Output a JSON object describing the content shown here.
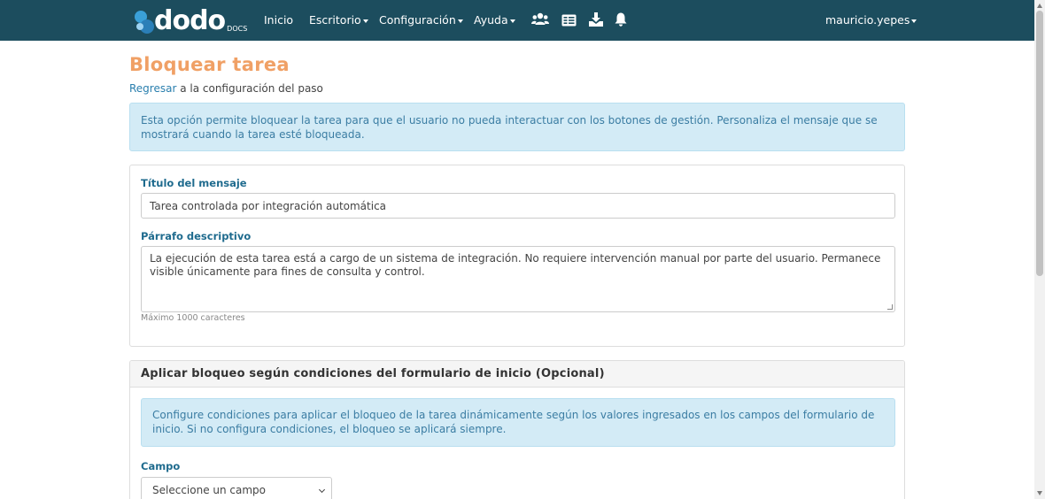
{
  "nav": {
    "brand": "dodo",
    "brand_sub": "DOCS",
    "items": [
      {
        "label": "Inicio"
      },
      {
        "label": "Escritorio"
      },
      {
        "label": "Configuración"
      },
      {
        "label": "Ayuda"
      }
    ],
    "icons": [
      "users-icon",
      "cards-icon",
      "download-icon",
      "bell-icon"
    ],
    "user": "mauricio.yepes"
  },
  "page": {
    "title": "Bloquear tarea",
    "back_link": "Regresar",
    "back_rest": " a la configuración del paso",
    "intro": "Esta opción permite bloquear la tarea para que el usuario no pueda interactuar con los botones de gestión. Personaliza el mensaje que se mostrará cuando la tarea esté bloqueada."
  },
  "form": {
    "title_label": "Título del mensaje",
    "title_value": "Tarea controlada por integración automática",
    "paragraph_label": "Párrafo descriptivo",
    "paragraph_value": "La ejecución de esta tarea está a cargo de un sistema de integración. No requiere intervención manual por parte del usuario. Permanece visible únicamente para fines de consulta y control.",
    "paragraph_help": "Máximo 1000 caracteres"
  },
  "conditions": {
    "header": "Aplicar bloqueo según condiciones del formulario de inicio (Opcional)",
    "info": "Configure condiciones para aplicar el bloqueo de la tarea dinámicamente según los valores ingresados en los campos del formulario de inicio. Si no configura condiciones, el bloqueo se aplicará siempre.",
    "field_label": "Campo",
    "field_selected": "Seleccione un campo"
  },
  "colors": {
    "navbar": "#1c4d5e",
    "title": "#f0a065",
    "link": "#2a7fae",
    "label": "#1f6b8e",
    "alert_bg": "#d3ebf6",
    "alert_text": "#3b7da3"
  }
}
